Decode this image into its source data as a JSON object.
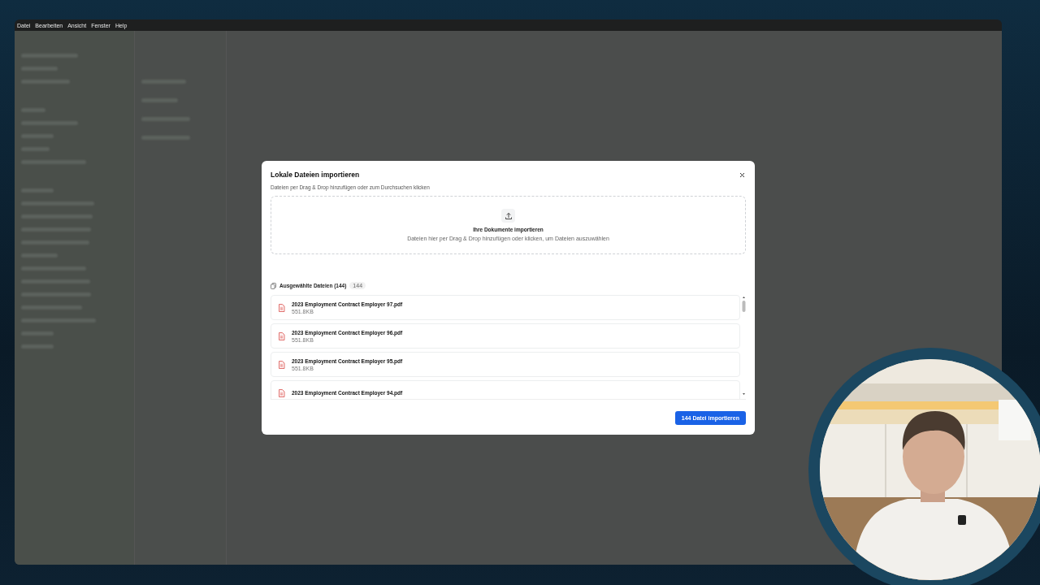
{
  "menu_bar": {
    "items": [
      "Datei",
      "Bearbeiten",
      "Ansicht",
      "Fenster",
      "Help"
    ]
  },
  "dialog": {
    "title": "Lokale Dateien importieren",
    "subtitle": "Dateien per Drag & Drop hinzufügen oder zum Durchsuchen klicken",
    "dropzone": {
      "title": "Ihre Dokumente importieren",
      "hint": "Dateien hier per Drag & Drop hinzufügen oder klicken, um Dateien auszuwählen"
    },
    "selected_files": {
      "label": "Ausgewählte Dateien (144)",
      "count": "144",
      "files": [
        {
          "name": "2023 Employment Contract Employer 97.pdf",
          "size": "551.8KB"
        },
        {
          "name": "2023 Employment Contract Employer 96.pdf",
          "size": "551.8KB"
        },
        {
          "name": "2023 Employment Contract Employer 95.pdf",
          "size": "551.8KB"
        },
        {
          "name": "2023 Employment Contract Employer 94.pdf"
        }
      ]
    },
    "import_button": "144 Datei importieren"
  }
}
